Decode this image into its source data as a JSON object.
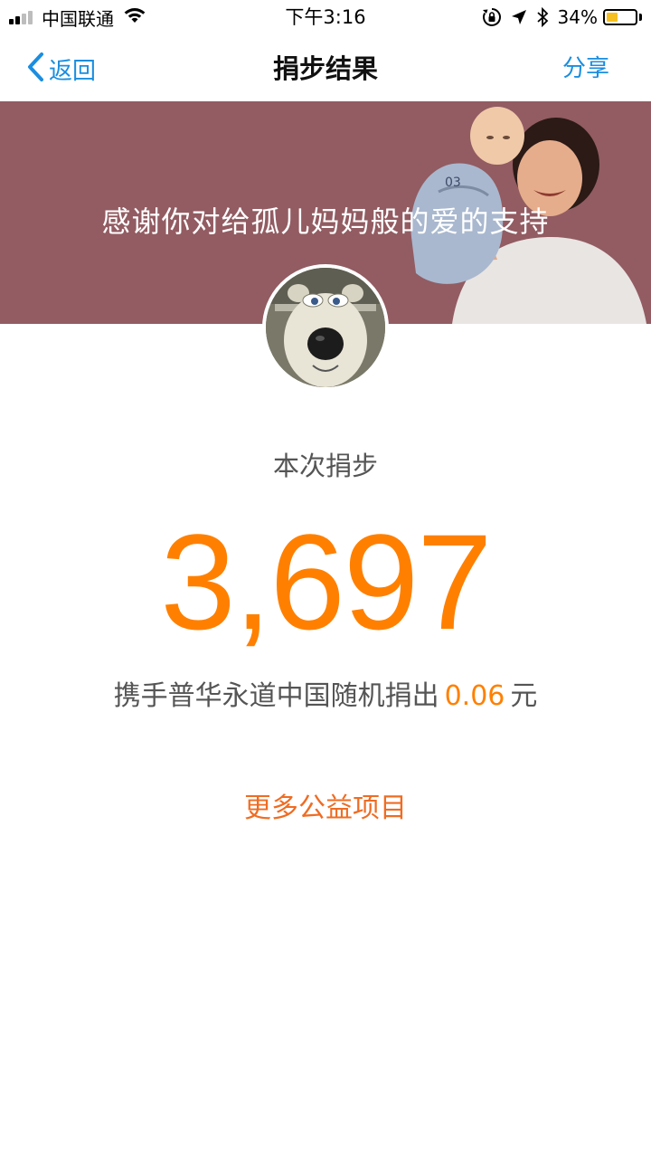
{
  "status_bar": {
    "carrier": "中国联通",
    "time": "下午3:16",
    "battery_percent": "34%",
    "battery_level": 0.34,
    "icons": [
      "signal-icon",
      "wifi-icon",
      "orientation-lock-icon",
      "location-icon",
      "bluetooth-icon",
      "battery-icon"
    ]
  },
  "nav": {
    "back_label": "返回",
    "title": "捐步结果",
    "share_label": "分享",
    "accent_color": "#1a8ee0"
  },
  "banner": {
    "title": "感谢你对给孤儿妈妈般的爱的支持",
    "background_color": "#925c62"
  },
  "result": {
    "steps_label": "本次捐步",
    "steps": "3,697",
    "donation_prefix": "携手普华永道中国随机捐出",
    "donation_amount": "0.06",
    "donation_unit": "元",
    "highlight_color": "#ff8000"
  },
  "more_link": {
    "label": "更多公益项目"
  }
}
